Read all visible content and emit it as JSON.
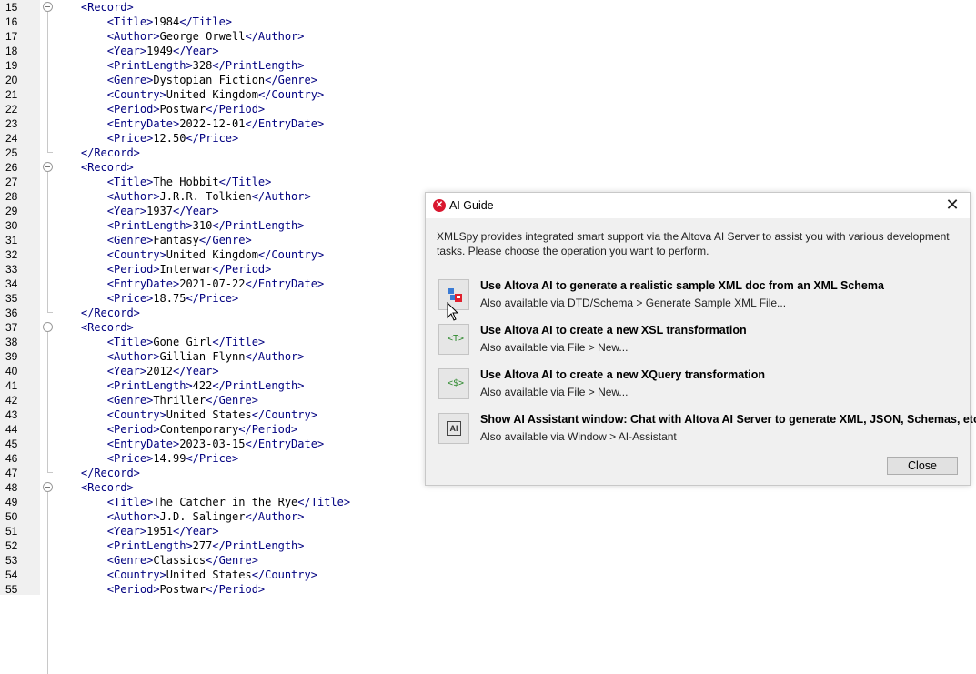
{
  "editor": {
    "lines": [
      {
        "n": "15",
        "indent": 1,
        "parts": [
          {
            "t": "<Record>",
            "k": "tag"
          }
        ],
        "fold": "open"
      },
      {
        "n": "16",
        "indent": 2,
        "parts": [
          {
            "t": "<Title>",
            "k": "tag"
          },
          {
            "t": "1984",
            "k": "txt"
          },
          {
            "t": "</Title>",
            "k": "tag"
          }
        ]
      },
      {
        "n": "17",
        "indent": 2,
        "parts": [
          {
            "t": "<Author>",
            "k": "tag"
          },
          {
            "t": "George Orwell",
            "k": "txt"
          },
          {
            "t": "</Author>",
            "k": "tag"
          }
        ]
      },
      {
        "n": "18",
        "indent": 2,
        "parts": [
          {
            "t": "<Year>",
            "k": "tag"
          },
          {
            "t": "1949",
            "k": "txt"
          },
          {
            "t": "</Year>",
            "k": "tag"
          }
        ]
      },
      {
        "n": "19",
        "indent": 2,
        "parts": [
          {
            "t": "<PrintLength>",
            "k": "tag"
          },
          {
            "t": "328",
            "k": "txt"
          },
          {
            "t": "</PrintLength>",
            "k": "tag"
          }
        ]
      },
      {
        "n": "20",
        "indent": 2,
        "parts": [
          {
            "t": "<Genre>",
            "k": "tag"
          },
          {
            "t": "Dystopian Fiction",
            "k": "txt"
          },
          {
            "t": "</Genre>",
            "k": "tag"
          }
        ]
      },
      {
        "n": "21",
        "indent": 2,
        "parts": [
          {
            "t": "<Country>",
            "k": "tag"
          },
          {
            "t": "United Kingdom",
            "k": "txt"
          },
          {
            "t": "</Country>",
            "k": "tag"
          }
        ]
      },
      {
        "n": "22",
        "indent": 2,
        "parts": [
          {
            "t": "<Period>",
            "k": "tag"
          },
          {
            "t": "Postwar",
            "k": "txt"
          },
          {
            "t": "</Period>",
            "k": "tag"
          }
        ]
      },
      {
        "n": "23",
        "indent": 2,
        "parts": [
          {
            "t": "<EntryDate>",
            "k": "tag"
          },
          {
            "t": "2022-12-01",
            "k": "txt"
          },
          {
            "t": "</EntryDate>",
            "k": "tag"
          }
        ]
      },
      {
        "n": "24",
        "indent": 2,
        "parts": [
          {
            "t": "<Price>",
            "k": "tag"
          },
          {
            "t": "12.50",
            "k": "txt"
          },
          {
            "t": "</Price>",
            "k": "tag"
          }
        ]
      },
      {
        "n": "25",
        "indent": 1,
        "parts": [
          {
            "t": "</Record>",
            "k": "tag"
          }
        ],
        "fold": "end"
      },
      {
        "n": "26",
        "indent": 1,
        "parts": [
          {
            "t": "<Record>",
            "k": "tag"
          }
        ],
        "fold": "open"
      },
      {
        "n": "27",
        "indent": 2,
        "parts": [
          {
            "t": "<Title>",
            "k": "tag"
          },
          {
            "t": "The Hobbit",
            "k": "txt"
          },
          {
            "t": "</Title>",
            "k": "tag"
          }
        ]
      },
      {
        "n": "28",
        "indent": 2,
        "parts": [
          {
            "t": "<Author>",
            "k": "tag"
          },
          {
            "t": "J.R.R. Tolkien",
            "k": "txt"
          },
          {
            "t": "</Author>",
            "k": "tag"
          }
        ]
      },
      {
        "n": "29",
        "indent": 2,
        "parts": [
          {
            "t": "<Year>",
            "k": "tag"
          },
          {
            "t": "1937",
            "k": "txt"
          },
          {
            "t": "</Year>",
            "k": "tag"
          }
        ]
      },
      {
        "n": "30",
        "indent": 2,
        "parts": [
          {
            "t": "<PrintLength>",
            "k": "tag"
          },
          {
            "t": "310",
            "k": "txt"
          },
          {
            "t": "</PrintLength>",
            "k": "tag"
          }
        ]
      },
      {
        "n": "31",
        "indent": 2,
        "parts": [
          {
            "t": "<Genre>",
            "k": "tag"
          },
          {
            "t": "Fantasy",
            "k": "txt"
          },
          {
            "t": "</Genre>",
            "k": "tag"
          }
        ]
      },
      {
        "n": "32",
        "indent": 2,
        "parts": [
          {
            "t": "<Country>",
            "k": "tag"
          },
          {
            "t": "United Kingdom",
            "k": "txt"
          },
          {
            "t": "</Country>",
            "k": "tag"
          }
        ]
      },
      {
        "n": "33",
        "indent": 2,
        "parts": [
          {
            "t": "<Period>",
            "k": "tag"
          },
          {
            "t": "Interwar",
            "k": "txt"
          },
          {
            "t": "</Period>",
            "k": "tag"
          }
        ]
      },
      {
        "n": "34",
        "indent": 2,
        "parts": [
          {
            "t": "<EntryDate>",
            "k": "tag"
          },
          {
            "t": "2021-07-22",
            "k": "txt"
          },
          {
            "t": "</EntryDate>",
            "k": "tag"
          }
        ]
      },
      {
        "n": "35",
        "indent": 2,
        "parts": [
          {
            "t": "<Price>",
            "k": "tag"
          },
          {
            "t": "18.75",
            "k": "txt"
          },
          {
            "t": "</Price>",
            "k": "tag"
          }
        ]
      },
      {
        "n": "36",
        "indent": 1,
        "parts": [
          {
            "t": "</Record>",
            "k": "tag"
          }
        ],
        "fold": "end"
      },
      {
        "n": "37",
        "indent": 1,
        "parts": [
          {
            "t": "<Record>",
            "k": "tag"
          }
        ],
        "fold": "open"
      },
      {
        "n": "38",
        "indent": 2,
        "parts": [
          {
            "t": "<Title>",
            "k": "tag"
          },
          {
            "t": "Gone Girl",
            "k": "txt"
          },
          {
            "t": "</Title>",
            "k": "tag"
          }
        ]
      },
      {
        "n": "39",
        "indent": 2,
        "parts": [
          {
            "t": "<Author>",
            "k": "tag"
          },
          {
            "t": "Gillian Flynn",
            "k": "txt"
          },
          {
            "t": "</Author>",
            "k": "tag"
          }
        ]
      },
      {
        "n": "40",
        "indent": 2,
        "parts": [
          {
            "t": "<Year>",
            "k": "tag"
          },
          {
            "t": "2012",
            "k": "txt"
          },
          {
            "t": "</Year>",
            "k": "tag"
          }
        ]
      },
      {
        "n": "41",
        "indent": 2,
        "parts": [
          {
            "t": "<PrintLength>",
            "k": "tag"
          },
          {
            "t": "422",
            "k": "txt"
          },
          {
            "t": "</PrintLength>",
            "k": "tag"
          }
        ]
      },
      {
        "n": "42",
        "indent": 2,
        "parts": [
          {
            "t": "<Genre>",
            "k": "tag"
          },
          {
            "t": "Thriller",
            "k": "txt"
          },
          {
            "t": "</Genre>",
            "k": "tag"
          }
        ]
      },
      {
        "n": "43",
        "indent": 2,
        "parts": [
          {
            "t": "<Country>",
            "k": "tag"
          },
          {
            "t": "United States",
            "k": "txt"
          },
          {
            "t": "</Country>",
            "k": "tag"
          }
        ]
      },
      {
        "n": "44",
        "indent": 2,
        "parts": [
          {
            "t": "<Period>",
            "k": "tag"
          },
          {
            "t": "Contemporary",
            "k": "txt"
          },
          {
            "t": "</Period>",
            "k": "tag"
          }
        ]
      },
      {
        "n": "45",
        "indent": 2,
        "parts": [
          {
            "t": "<EntryDate>",
            "k": "tag"
          },
          {
            "t": "2023-03-15",
            "k": "txt"
          },
          {
            "t": "</EntryDate>",
            "k": "tag"
          }
        ]
      },
      {
        "n": "46",
        "indent": 2,
        "parts": [
          {
            "t": "<Price>",
            "k": "tag"
          },
          {
            "t": "14.99",
            "k": "txt"
          },
          {
            "t": "</Price>",
            "k": "tag"
          }
        ]
      },
      {
        "n": "47",
        "indent": 1,
        "parts": [
          {
            "t": "</Record>",
            "k": "tag"
          }
        ],
        "fold": "end"
      },
      {
        "n": "48",
        "indent": 1,
        "parts": [
          {
            "t": "<Record>",
            "k": "tag"
          }
        ],
        "fold": "open"
      },
      {
        "n": "49",
        "indent": 2,
        "parts": [
          {
            "t": "<Title>",
            "k": "tag"
          },
          {
            "t": "The Catcher in the Rye",
            "k": "txt"
          },
          {
            "t": "</Title>",
            "k": "tag"
          }
        ]
      },
      {
        "n": "50",
        "indent": 2,
        "parts": [
          {
            "t": "<Author>",
            "k": "tag"
          },
          {
            "t": "J.D. Salinger",
            "k": "txt"
          },
          {
            "t": "</Author>",
            "k": "tag"
          }
        ]
      },
      {
        "n": "51",
        "indent": 2,
        "parts": [
          {
            "t": "<Year>",
            "k": "tag"
          },
          {
            "t": "1951",
            "k": "txt"
          },
          {
            "t": "</Year>",
            "k": "tag"
          }
        ]
      },
      {
        "n": "52",
        "indent": 2,
        "parts": [
          {
            "t": "<PrintLength>",
            "k": "tag"
          },
          {
            "t": "277",
            "k": "txt"
          },
          {
            "t": "</PrintLength>",
            "k": "tag"
          }
        ]
      },
      {
        "n": "53",
        "indent": 2,
        "parts": [
          {
            "t": "<Genre>",
            "k": "tag"
          },
          {
            "t": "Classics",
            "k": "txt"
          },
          {
            "t": "</Genre>",
            "k": "tag"
          }
        ]
      },
      {
        "n": "54",
        "indent": 2,
        "parts": [
          {
            "t": "<Country>",
            "k": "tag"
          },
          {
            "t": "United States",
            "k": "txt"
          },
          {
            "t": "</Country>",
            "k": "tag"
          }
        ]
      },
      {
        "n": "55",
        "indent": 2,
        "parts": [
          {
            "t": "<Period>",
            "k": "tag"
          },
          {
            "t": "Postwar",
            "k": "txt"
          },
          {
            "t": "</Period>",
            "k": "tag"
          }
        ]
      }
    ],
    "colors": {
      "tag": "#000080",
      "text": "#000000"
    }
  },
  "dialog": {
    "title": "AI Guide",
    "description": "XMLSpy provides integrated smart support via the Altova AI Server to assist you with various development tasks. Please choose the operation you want to perform.",
    "operations": [
      {
        "title": "Use Altova AI to generate a realistic sample XML doc from an XML Schema",
        "subtitle": "Also available via DTD/Schema > Generate Sample XML File...",
        "icon": "xml-schema-icon"
      },
      {
        "title": "Use Altova AI to create a new XSL transformation",
        "subtitle": "Also available via File > New...",
        "icon": "xsl-icon",
        "glyph": "<T>"
      },
      {
        "title": "Use Altova AI to create a new XQuery transformation",
        "subtitle": "Also available via File > New...",
        "icon": "xquery-icon",
        "glyph": "<$>"
      },
      {
        "title": "Show AI Assistant window: Chat with Altova AI Server to generate XML, JSON, Schemas, etc.",
        "subtitle": "Also available via Window > AI-Assistant",
        "icon": "ai-assistant-icon",
        "glyph": "AI"
      }
    ],
    "close_label": "Close",
    "brand_color": "#d9162e"
  }
}
